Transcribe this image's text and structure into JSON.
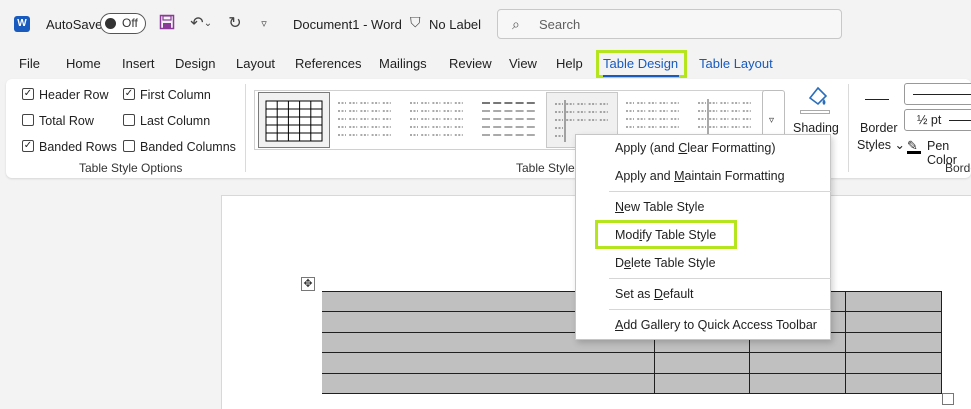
{
  "titlebar": {
    "logo": "W",
    "autosave_label": "AutoSave",
    "autosave_state": "Off",
    "document_title": "Document1  -  Word",
    "sensitivity_label": "No Label",
    "search_placeholder": "Search"
  },
  "tabs": [
    {
      "label": "File"
    },
    {
      "label": "Home"
    },
    {
      "label": "Insert"
    },
    {
      "label": "Design"
    },
    {
      "label": "Layout"
    },
    {
      "label": "References"
    },
    {
      "label": "Mailings"
    },
    {
      "label": "Review"
    },
    {
      "label": "View"
    },
    {
      "label": "Help"
    },
    {
      "label": "Table Design",
      "active": true
    },
    {
      "label": "Table Layout",
      "contextual": true
    }
  ],
  "style_options": {
    "group_label": "Table Style Options",
    "items": [
      {
        "label": "Header Row",
        "checked": true
      },
      {
        "label": "Total Row",
        "checked": false
      },
      {
        "label": "Banded Rows",
        "checked": true
      },
      {
        "label": "First Column",
        "checked": true
      },
      {
        "label": "Last Column",
        "checked": false
      },
      {
        "label": "Banded Columns",
        "checked": false
      }
    ]
  },
  "table_styles": {
    "group_label": "Table Styles",
    "swatch_count": 7,
    "selected_index": 0,
    "hover_index": 4
  },
  "shading": {
    "label": "Shading"
  },
  "borders": {
    "border_styles_label_1": "Border",
    "border_styles_label_2": "Styles",
    "pen_weight": "½ pt",
    "pen_color_label": "Pen Color",
    "group_label": "Borders"
  },
  "context_menu": {
    "items": [
      {
        "prefix": "Apply (and ",
        "accel": "C",
        "suffix": "lear Formatting)"
      },
      {
        "prefix": "Apply and ",
        "accel": "M",
        "suffix": "aintain Formatting"
      },
      {
        "prefix": "",
        "accel": "N",
        "suffix": "ew Table Style"
      },
      {
        "prefix": "Mod",
        "accel": "i",
        "suffix": "fy Table Style"
      },
      {
        "prefix": "D",
        "accel": "e",
        "suffix": "lete Table Style"
      },
      {
        "prefix": "Set as ",
        "accel": "D",
        "suffix": "efault"
      },
      {
        "prefix": "",
        "accel": "A",
        "suffix": "dd Gallery to Quick Access Toolbar"
      }
    ]
  },
  "colors": {
    "accent": "#185abd",
    "highlight": "#b5e61d",
    "table_fill": "#c0c0c0"
  },
  "icons": {
    "save": "save-icon",
    "undo": "undo-icon",
    "redo": "redo-icon",
    "search": "search-icon",
    "sensitivity": "shield-icon",
    "move": "move-handle-icon",
    "shading": "paint-bucket-icon",
    "pen": "pen-icon"
  }
}
